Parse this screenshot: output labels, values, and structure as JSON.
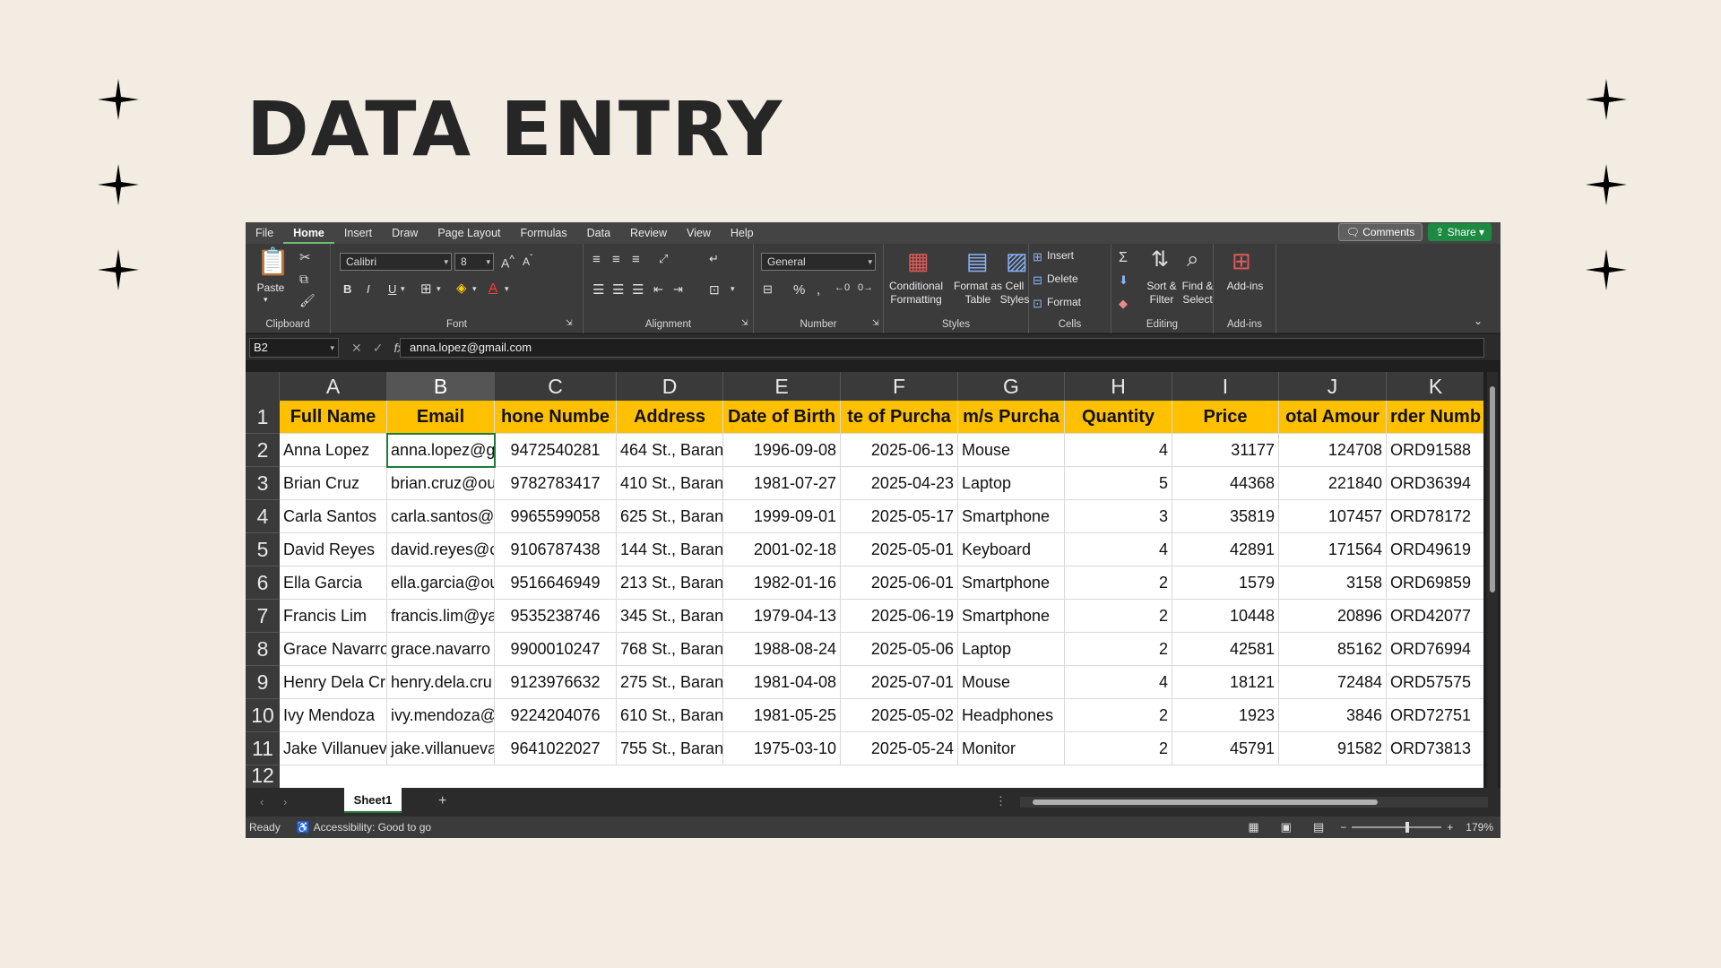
{
  "slide": {
    "title": "DATA ENTRY"
  },
  "menu": {
    "tabs": [
      "File",
      "Home",
      "Insert",
      "Draw",
      "Page Layout",
      "Formulas",
      "Data",
      "Review",
      "View",
      "Help"
    ],
    "active_tab": "Home",
    "comments_label": "Comments",
    "share_label": "Share"
  },
  "ribbon": {
    "clipboard": {
      "label": "Clipboard",
      "paste": "Paste"
    },
    "font": {
      "label": "Font",
      "name": "Calibri",
      "size": "8",
      "bold": "B",
      "italic": "I",
      "underline": "U"
    },
    "alignment": {
      "label": "Alignment"
    },
    "number": {
      "label": "Number",
      "format": "General"
    },
    "styles": {
      "label": "Styles",
      "conditional": "Conditional\nFormatting",
      "format_table": "Format as\nTable",
      "cell_styles": "Cell\nStyles"
    },
    "cells": {
      "label": "Cells",
      "insert": "Insert",
      "delete": "Delete",
      "format": "Format"
    },
    "editing": {
      "label": "Editing",
      "sort": "Sort &\nFilter",
      "find": "Find &\nSelect"
    },
    "addins": {
      "label": "Add-ins",
      "addins": "Add-ins"
    }
  },
  "formula_bar": {
    "cell_ref": "B2",
    "fx": "fx",
    "value": "anna.lopez@gmail.com"
  },
  "grid": {
    "columns": [
      "A",
      "B",
      "C",
      "D",
      "E",
      "F",
      "G",
      "H",
      "I",
      "J",
      "K"
    ],
    "selected_column": "B",
    "headers": [
      "Full Name",
      "Email",
      "hone Numbe",
      "Address",
      "Date of Birth",
      "te of Purcha",
      "m/s Purcha",
      "Quantity",
      "Price",
      "otal Amour",
      "rder Numb"
    ],
    "rows": [
      {
        "n": "2",
        "cells": [
          "Anna Lopez",
          "anna.lopez@g",
          "9472540281",
          "464 St., Baran",
          "1996-09-08",
          "2025-06-13",
          "Mouse",
          "4",
          "31177",
          "124708",
          "ORD91588"
        ]
      },
      {
        "n": "3",
        "cells": [
          "Brian Cruz",
          "brian.cruz@ou",
          "9782783417",
          "410  St., Baran",
          "1981-07-27",
          "2025-04-23",
          "Laptop",
          "5",
          "44368",
          "221840",
          "ORD36394"
        ]
      },
      {
        "n": "4",
        "cells": [
          "Carla Santos",
          "carla.santos@",
          "9965599058",
          "625 St., Baran",
          "1999-09-01",
          "2025-05-17",
          "Smartphone",
          "3",
          "35819",
          "107457",
          "ORD78172"
        ]
      },
      {
        "n": "5",
        "cells": [
          "David Reyes",
          "david.reyes@c",
          "9106787438",
          "144 St., Baran",
          "2001-02-18",
          "2025-05-01",
          "Keyboard",
          "4",
          "42891",
          "171564",
          "ORD49619"
        ]
      },
      {
        "n": "6",
        "cells": [
          "Ella Garcia",
          "ella.garcia@ou",
          "9516646949",
          "213 St., Baran",
          "1982-01-16",
          "2025-06-01",
          "Smartphone",
          "2",
          "1579",
          "3158",
          "ORD69859"
        ]
      },
      {
        "n": "7",
        "cells": [
          "Francis Lim",
          "francis.lim@ya",
          "9535238746",
          "345 St., Baran",
          "1979-04-13",
          "2025-06-19",
          "Smartphone",
          "2",
          "10448",
          "20896",
          "ORD42077"
        ]
      },
      {
        "n": "8",
        "cells": [
          "Grace Navarro",
          "grace.navarro",
          "9900010247",
          "768 St., Baran",
          "1988-08-24",
          "2025-05-06",
          "Laptop",
          "2",
          "42581",
          "85162",
          "ORD76994"
        ]
      },
      {
        "n": "9",
        "cells": [
          "Henry Dela Cru",
          "henry.dela.cru",
          "9123976632",
          "275 St., Baran",
          "1981-04-08",
          "2025-07-01",
          "Mouse",
          "4",
          "18121",
          "72484",
          "ORD57575"
        ]
      },
      {
        "n": "10",
        "cells": [
          "Ivy Mendoza",
          "ivy.mendoza@",
          "9224204076",
          "610 St., Baran",
          "1981-05-25",
          "2025-05-02",
          "Headphones",
          "2",
          "1923",
          "3846",
          "ORD72751"
        ]
      },
      {
        "n": "11",
        "cells": [
          "Jake Villanueva",
          "jake.villanueva",
          "9641022027",
          "755 St., Baran",
          "1975-03-10",
          "2025-05-24",
          "Monitor",
          "2",
          "45791",
          "91582",
          "ORD73813"
        ]
      }
    ]
  },
  "sheets": {
    "active": "Sheet1",
    "add": "+"
  },
  "status": {
    "ready": "Ready",
    "accessibility": "Accessibility: Good to go",
    "zoom": "179%"
  }
}
